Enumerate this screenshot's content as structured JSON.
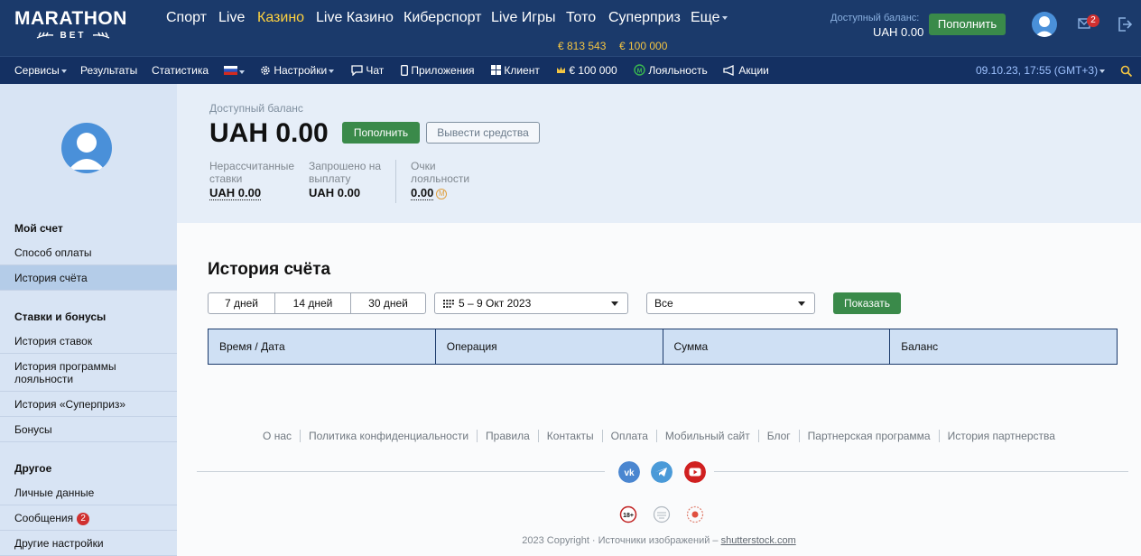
{
  "logo": {
    "line1": "MARATHON",
    "line2": "BET"
  },
  "nav": [
    {
      "label": "Спорт"
    },
    {
      "label": "Live"
    },
    {
      "label": "Казино",
      "active": true
    },
    {
      "label": "Live Казино"
    },
    {
      "label": "Киберспорт"
    },
    {
      "label": "Live Игры"
    },
    {
      "label": "Тото",
      "sub": "€ 813 543"
    },
    {
      "label": "Суперприз",
      "sub": "€ 100 000"
    },
    {
      "label": "Еще"
    }
  ],
  "header": {
    "balance_label": "Доступный баланс:",
    "balance_value": "UAH 0.00",
    "topup_label": "Пополнить",
    "mail_badge": "2"
  },
  "subnav": {
    "services": "Сервисы",
    "results": "Результаты",
    "stats": "Статистика",
    "settings": "Настройки",
    "chat": "Чат",
    "apps": "Приложения",
    "client": "Клиент",
    "jackpot": "€ 100 000",
    "loyalty": "Лояльность",
    "promos": "Акции",
    "datetime": "09.10.23, 17:55 (GMT+3)"
  },
  "sidebar": {
    "sections": [
      {
        "title": "Мой счет",
        "items": [
          "Способ оплаты",
          "История счёта"
        ]
      },
      {
        "title": "Ставки и бонусы",
        "items": [
          "История ставок",
          "История программы лояльности",
          "История «Суперприз»",
          "Бонусы"
        ]
      },
      {
        "title": "Другое",
        "items": [
          "Личные данные",
          "Сообщения",
          "Другие настройки"
        ]
      }
    ],
    "messages_badge": "2",
    "selected": "История счёта"
  },
  "balance_box": {
    "label": "Доступный баланс",
    "value": "UAH 0.00",
    "topup_label": "Пополнить",
    "withdraw_label": "Вывести средства",
    "stats": [
      {
        "label": "Нерассчитанные ставки",
        "value": "UAH 0.00"
      },
      {
        "label": "Запрошено на выплату",
        "value": "UAH 0.00"
      },
      {
        "label": "Очки лояльности",
        "value": "0.00"
      }
    ]
  },
  "history": {
    "title": "История счёта",
    "periods": [
      "7 дней",
      "14 дней",
      "30 дней"
    ],
    "date_range": "5 – 9 Окт 2023",
    "type_select": "Все",
    "show_label": "Показать",
    "columns": [
      "Время / Дата",
      "Операция",
      "Сумма",
      "Баланс"
    ]
  },
  "footer": {
    "links": [
      "О нас",
      "Политика конфиденциальности",
      "Правила",
      "Контакты",
      "Оплата",
      "Мобильный сайт",
      "Блог",
      "Партнерская программа",
      "История партнерства"
    ],
    "age_badge": "18+",
    "copyright": "2023 Copyright · Источники изображений – ",
    "copyright_link": "shutterstock.com"
  },
  "colors": {
    "header": "#1b3a6b",
    "accent_green": "#3a8a4a",
    "active_nav": "#ffd23f",
    "jackpot": "#f4c542"
  }
}
